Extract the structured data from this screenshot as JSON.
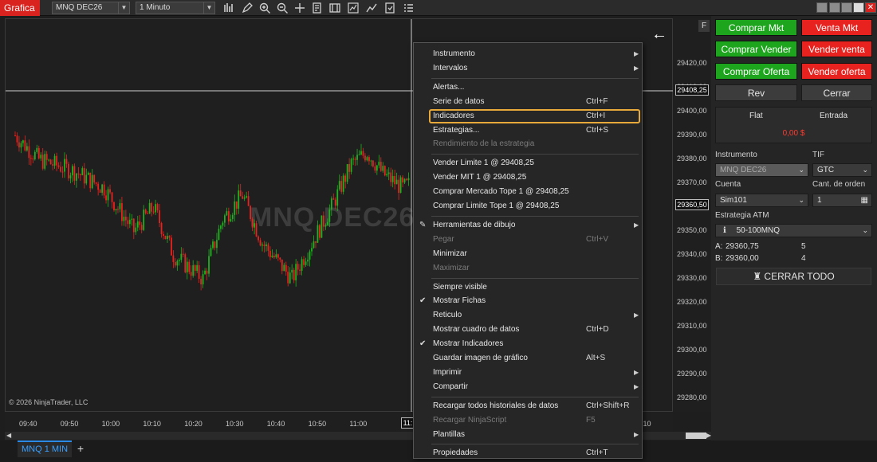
{
  "app_title": "Grafica",
  "toolbar": {
    "instrument": "MNQ DEC26",
    "interval": "1 Minuto"
  },
  "chart": {
    "watermark": "MNQ DEC26",
    "copyright": "© 2026 NinjaTrader, LLC",
    "price_ticks": [
      "29420,00",
      "29410,00",
      "29400,00",
      "29390,00",
      "29380,00",
      "29370,00",
      "29360,00",
      "29350,00",
      "29340,00",
      "29330,00",
      "29320,00",
      "29310,00",
      "29300,00",
      "29290,00",
      "29280,00"
    ],
    "price_tag_top": "29408,25",
    "price_tag_last": "29360,50",
    "time_ticks": [
      "09:40",
      "09:50",
      "10:00",
      "10:10",
      "10:20",
      "10:30",
      "10:40",
      "10:50",
      "11:00",
      "11:10"
    ],
    "time_tag": "11:1",
    "time_edge": ":10",
    "f_label": "F",
    "back_arrow": "←"
  },
  "tabs": {
    "active": "MNQ 1 MIN",
    "add": "+"
  },
  "panel": {
    "buy_mkt": "Comprar Mkt",
    "sell_mkt": "Venta Mkt",
    "buy_sell": "Comprar Vender",
    "sell_sell": "Vender venta",
    "buy_offer": "Comprar Oferta",
    "sell_offer": "Vender oferta",
    "rev": "Rev",
    "close": "Cerrar",
    "pos_flat": "Flat",
    "pos_entry": "Entrada",
    "pnl": "0,00 $",
    "instrument_label": "Instrumento",
    "instrument_value": "MNQ DEC26",
    "tif_label": "TIF",
    "tif_value": "GTC",
    "account_label": "Cuenta",
    "account_value": "Sim101",
    "qty_label": "Cant. de orden",
    "qty_value": "1",
    "atm_label": "Estrategia ATM",
    "atm_value": "50-100MNQ",
    "ask_label": "A:",
    "ask_price": "29360,75",
    "ask_size": "5",
    "bid_label": "B:",
    "bid_price": "29360,00",
    "bid_size": "4",
    "close_all": "CERRAR TODO",
    "colors": {
      "buy": "#1ea51e",
      "sell": "#e8231f"
    }
  },
  "menu": [
    {
      "label": "Instrumento",
      "sub": true
    },
    {
      "label": "Intervalos",
      "sub": true
    },
    {
      "sep": true
    },
    {
      "label": "Alertas..."
    },
    {
      "label": "Serie de datos",
      "shortcut": "Ctrl+F"
    },
    {
      "label": "Indicadores",
      "shortcut": "Ctrl+I",
      "highlight": true
    },
    {
      "label": "Estrategias...",
      "shortcut": "Ctrl+S"
    },
    {
      "label": "Rendimiento de la estrategia",
      "disabled": true
    },
    {
      "sep": true
    },
    {
      "label": "Vender Limite 1 @ 29408,25"
    },
    {
      "label": "Vender MIT 1 @ 29408,25"
    },
    {
      "label": "Comprar Mercado Tope 1 @ 29408,25"
    },
    {
      "label": "Comprar Limite Tope 1 @ 29408,25"
    },
    {
      "sep": true
    },
    {
      "label": "Herramientas de dibujo",
      "sub": true,
      "icon": "pencil"
    },
    {
      "label": "Pegar",
      "shortcut": "Ctrl+V",
      "disabled": true
    },
    {
      "label": "Minimizar"
    },
    {
      "label": "Maximizar",
      "disabled": true
    },
    {
      "sep": true
    },
    {
      "label": "Siempre visible"
    },
    {
      "label": "Mostrar Fichas",
      "checked": true
    },
    {
      "label": "Reticulo",
      "sub": true
    },
    {
      "label": "Mostrar cuadro de datos",
      "shortcut": "Ctrl+D"
    },
    {
      "label": "Mostrar Indicadores",
      "checked": true
    },
    {
      "label": "Guardar imagen de gráfico",
      "shortcut": "Alt+S"
    },
    {
      "label": "Imprimir",
      "sub": true
    },
    {
      "label": "Compartir",
      "sub": true
    },
    {
      "sep": true
    },
    {
      "label": "Recargar todos historiales de datos",
      "shortcut": "Ctrl+Shift+R"
    },
    {
      "label": "Recargar NinjaScript",
      "shortcut": "F5",
      "disabled": true
    },
    {
      "label": "Plantillas",
      "sub": true
    },
    {
      "sep": true
    },
    {
      "label": "Propiedades",
      "shortcut": "Ctrl+T"
    }
  ]
}
